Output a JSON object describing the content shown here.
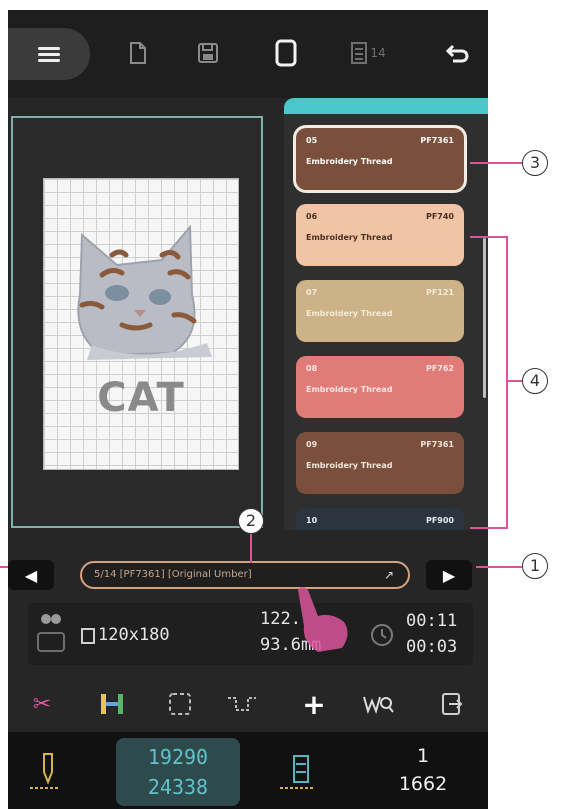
{
  "toolbar": {
    "menu_icon": "hamburger-icon",
    "page_count_label": "14"
  },
  "design": {
    "text": "CAT"
  },
  "threads": [
    {
      "number": "05",
      "code": "PF7361",
      "label": "Embroidery Thread",
      "color": "#7a4f3b",
      "text_color": "#ffffff",
      "selected": true
    },
    {
      "number": "06",
      "code": "PF740",
      "label": "Embroidery Thread",
      "color": "#f1c4a5",
      "text_color": "#4a3024",
      "selected": false
    },
    {
      "number": "07",
      "code": "PF121",
      "label": "Embroidery Thread",
      "color": "#cdb287",
      "text_color": "#f3ead8",
      "selected": false
    },
    {
      "number": "08",
      "code": "PF762",
      "label": "Embroidery Thread",
      "color": "#e17b78",
      "text_color": "#fde6e4",
      "selected": false
    },
    {
      "number": "09",
      "code": "PF7361",
      "label": "Embroidery Thread",
      "color": "#7a4f3b",
      "text_color": "#f1e4dc",
      "selected": false
    },
    {
      "number": "10",
      "code": "PF900",
      "label": "",
      "color": "#2c3440",
      "text_color": "#e9edf1",
      "selected": false
    }
  ],
  "info_bar": {
    "text": "5/14 [PF7361] [Original Umber]"
  },
  "stats": {
    "size": "120x180",
    "width_value": "122.",
    "height_value": "93.6mm",
    "time_total": "00:11",
    "time_remaining": "00:03"
  },
  "counters": {
    "stitch_current": "19290",
    "stitch_total": "24338",
    "color_current": "1",
    "color_total": "1662"
  },
  "callouts": [
    "1",
    "2",
    "3",
    "4"
  ],
  "colors": {
    "accent_teal": "#48c8c8",
    "tool_pink": "#e0559d",
    "stitch_teal": "#5fc3c9",
    "callout_line": "#d9559b"
  }
}
